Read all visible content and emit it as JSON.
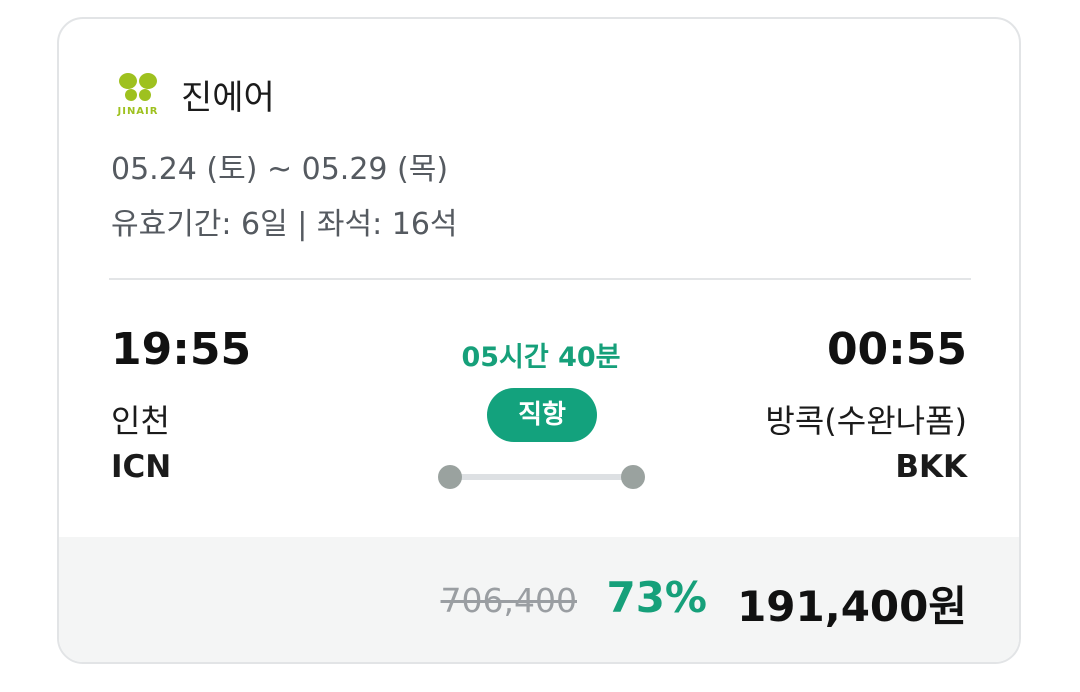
{
  "airline": {
    "name": "진에어",
    "logo_icon": "jinair-butterfly-logo",
    "logo_text": "JINAIR",
    "logo_color": "#9ec11f"
  },
  "trip": {
    "dates": "05.24 (토) ~ 05.29 (목)",
    "validity": "유효기간: 6일 | 좌석: 16석"
  },
  "flight": {
    "departure": {
      "time": "19:55",
      "city": "인천",
      "code": "ICN"
    },
    "arrival": {
      "time": "00:55",
      "city": "방콕(수완나폼)",
      "code": "BKK"
    },
    "duration": "05시간 40분",
    "type": "직항"
  },
  "price": {
    "original": "706,400",
    "discount": "73%",
    "final": "191,400원"
  },
  "colors": {
    "accent": "#13a27d",
    "text": "#111111",
    "muted": "#555a60"
  }
}
